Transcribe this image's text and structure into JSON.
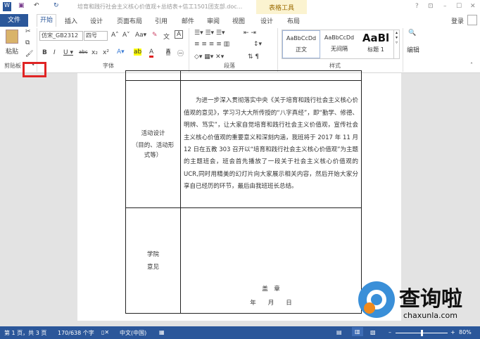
{
  "title": "培育和践行社会主义核心价值观+总结表+信工1501团支部.doc...",
  "context_tab": "表格工具",
  "window_controls": [
    "?",
    "⊡",
    "–",
    "☐",
    "✕"
  ],
  "tabs": [
    "文件",
    "开始",
    "插入",
    "设计",
    "页面布局",
    "引用",
    "邮件",
    "审阅",
    "视图",
    "设计",
    "布局"
  ],
  "login": "登录",
  "ribbon": {
    "paste": "粘贴",
    "font_name": "仿宋_GB2312",
    "font_size": "四号",
    "styles": [
      {
        "preview": "AaBbCcDd",
        "name": "正文"
      },
      {
        "preview": "AaBbCcDd",
        "name": "无间隔"
      },
      {
        "preview": "AaBl",
        "name": "标题 1"
      }
    ],
    "edit": "编辑",
    "groups": [
      "剪贴板",
      "字体",
      "段落",
      "样式"
    ]
  },
  "doc": {
    "row2_label1": "活动设计",
    "row2_label2": "（目的、活动形式等）",
    "row2_text": "为进一步深入贯彻落实中央《关于培育和践行社会主义核心价值观的意见》，学习习大大所传授的“八字真经”，即“勤学、修德、明辨、笃实”，让大家自觉培育和践行社会主义价值观，宣传社会主义核心价值观的重要意义和深刻内涵，我班将于 2017 年 11 月 12 日在五教 303 召开以“培育和践行社会主义核心价值观”为主题的主题班会，班会首先播放了一段关于社会主义核心价值观的 UCR,同时用精美的幻灯片向大家展示相关内容，然后开始大家分享自已经历的环节，最后由我班班长总结。",
    "row3_label1": "学院",
    "row3_label2": "意见",
    "seal": "盖　章",
    "date": "年　　月　　日"
  },
  "status": {
    "page": "第 1 页，共 3 页",
    "words": "170/638 个字",
    "lang": "中文(中国)",
    "zoom": "80%",
    "zoom_fraction": 0.5
  },
  "watermark": {
    "brand": "查询啦",
    "url": "chaxunla.com"
  }
}
